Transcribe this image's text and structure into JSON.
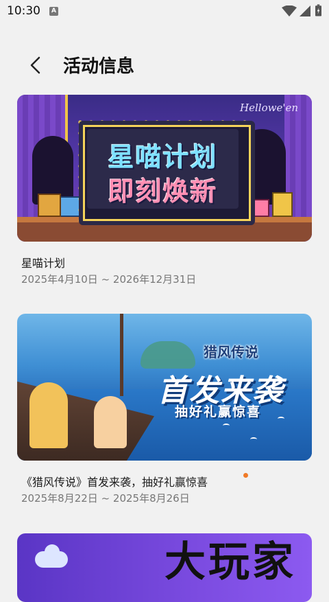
{
  "status_bar": {
    "time": "10:30",
    "notification_icon": "A",
    "icons": [
      "wifi-icon",
      "signal-icon",
      "battery-icon"
    ]
  },
  "header": {
    "back_icon": "chevron-left-icon",
    "title": "活动信息"
  },
  "activities": [
    {
      "banner": {
        "headline_line1": "星喵计划",
        "headline_line2": "即刻焕新",
        "tag": "Hellowe'en"
      },
      "title": "星喵计划",
      "date_range": "2025年4月10日 ~ 2026年12月31日",
      "new_dot": false
    },
    {
      "banner": {
        "logo": "猎风传说",
        "headline": "首发来袭",
        "subline": "抽好礼赢惊喜"
      },
      "title": "《猎风传说》首发来袭，抽好礼赢惊喜",
      "date_range": "2025年8月22日 ~ 2025年8月26日",
      "new_dot": true
    }
  ],
  "watermark": "大玩家",
  "colors": {
    "background": "#f1f1f1",
    "new_dot": "#f07a27",
    "date_text": "#777777"
  }
}
